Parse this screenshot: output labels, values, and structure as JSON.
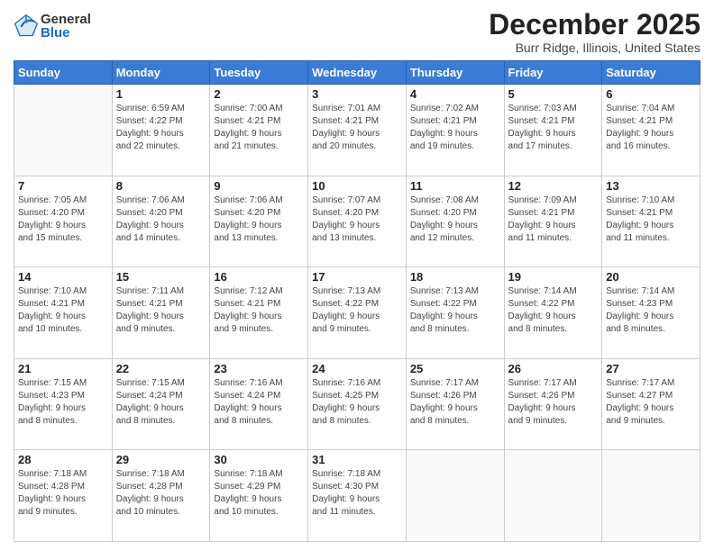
{
  "logo": {
    "general": "General",
    "blue": "Blue"
  },
  "header": {
    "title": "December 2025",
    "subtitle": "Burr Ridge, Illinois, United States"
  },
  "days_of_week": [
    "Sunday",
    "Monday",
    "Tuesday",
    "Wednesday",
    "Thursday",
    "Friday",
    "Saturday"
  ],
  "weeks": [
    [
      {
        "day": "",
        "info": ""
      },
      {
        "day": "1",
        "info": "Sunrise: 6:59 AM\nSunset: 4:22 PM\nDaylight: 9 hours\nand 22 minutes."
      },
      {
        "day": "2",
        "info": "Sunrise: 7:00 AM\nSunset: 4:21 PM\nDaylight: 9 hours\nand 21 minutes."
      },
      {
        "day": "3",
        "info": "Sunrise: 7:01 AM\nSunset: 4:21 PM\nDaylight: 9 hours\nand 20 minutes."
      },
      {
        "day": "4",
        "info": "Sunrise: 7:02 AM\nSunset: 4:21 PM\nDaylight: 9 hours\nand 19 minutes."
      },
      {
        "day": "5",
        "info": "Sunrise: 7:03 AM\nSunset: 4:21 PM\nDaylight: 9 hours\nand 17 minutes."
      },
      {
        "day": "6",
        "info": "Sunrise: 7:04 AM\nSunset: 4:21 PM\nDaylight: 9 hours\nand 16 minutes."
      }
    ],
    [
      {
        "day": "7",
        "info": "Sunrise: 7:05 AM\nSunset: 4:20 PM\nDaylight: 9 hours\nand 15 minutes."
      },
      {
        "day": "8",
        "info": "Sunrise: 7:06 AM\nSunset: 4:20 PM\nDaylight: 9 hours\nand 14 minutes."
      },
      {
        "day": "9",
        "info": "Sunrise: 7:06 AM\nSunset: 4:20 PM\nDaylight: 9 hours\nand 13 minutes."
      },
      {
        "day": "10",
        "info": "Sunrise: 7:07 AM\nSunset: 4:20 PM\nDaylight: 9 hours\nand 13 minutes."
      },
      {
        "day": "11",
        "info": "Sunrise: 7:08 AM\nSunset: 4:20 PM\nDaylight: 9 hours\nand 12 minutes."
      },
      {
        "day": "12",
        "info": "Sunrise: 7:09 AM\nSunset: 4:21 PM\nDaylight: 9 hours\nand 11 minutes."
      },
      {
        "day": "13",
        "info": "Sunrise: 7:10 AM\nSunset: 4:21 PM\nDaylight: 9 hours\nand 11 minutes."
      }
    ],
    [
      {
        "day": "14",
        "info": "Sunrise: 7:10 AM\nSunset: 4:21 PM\nDaylight: 9 hours\nand 10 minutes."
      },
      {
        "day": "15",
        "info": "Sunrise: 7:11 AM\nSunset: 4:21 PM\nDaylight: 9 hours\nand 9 minutes."
      },
      {
        "day": "16",
        "info": "Sunrise: 7:12 AM\nSunset: 4:21 PM\nDaylight: 9 hours\nand 9 minutes."
      },
      {
        "day": "17",
        "info": "Sunrise: 7:13 AM\nSunset: 4:22 PM\nDaylight: 9 hours\nand 9 minutes."
      },
      {
        "day": "18",
        "info": "Sunrise: 7:13 AM\nSunset: 4:22 PM\nDaylight: 9 hours\nand 8 minutes."
      },
      {
        "day": "19",
        "info": "Sunrise: 7:14 AM\nSunset: 4:22 PM\nDaylight: 9 hours\nand 8 minutes."
      },
      {
        "day": "20",
        "info": "Sunrise: 7:14 AM\nSunset: 4:23 PM\nDaylight: 9 hours\nand 8 minutes."
      }
    ],
    [
      {
        "day": "21",
        "info": "Sunrise: 7:15 AM\nSunset: 4:23 PM\nDaylight: 9 hours\nand 8 minutes."
      },
      {
        "day": "22",
        "info": "Sunrise: 7:15 AM\nSunset: 4:24 PM\nDaylight: 9 hours\nand 8 minutes."
      },
      {
        "day": "23",
        "info": "Sunrise: 7:16 AM\nSunset: 4:24 PM\nDaylight: 9 hours\nand 8 minutes."
      },
      {
        "day": "24",
        "info": "Sunrise: 7:16 AM\nSunset: 4:25 PM\nDaylight: 9 hours\nand 8 minutes."
      },
      {
        "day": "25",
        "info": "Sunrise: 7:17 AM\nSunset: 4:26 PM\nDaylight: 9 hours\nand 8 minutes."
      },
      {
        "day": "26",
        "info": "Sunrise: 7:17 AM\nSunset: 4:26 PM\nDaylight: 9 hours\nand 9 minutes."
      },
      {
        "day": "27",
        "info": "Sunrise: 7:17 AM\nSunset: 4:27 PM\nDaylight: 9 hours\nand 9 minutes."
      }
    ],
    [
      {
        "day": "28",
        "info": "Sunrise: 7:18 AM\nSunset: 4:28 PM\nDaylight: 9 hours\nand 9 minutes."
      },
      {
        "day": "29",
        "info": "Sunrise: 7:18 AM\nSunset: 4:28 PM\nDaylight: 9 hours\nand 10 minutes."
      },
      {
        "day": "30",
        "info": "Sunrise: 7:18 AM\nSunset: 4:29 PM\nDaylight: 9 hours\nand 10 minutes."
      },
      {
        "day": "31",
        "info": "Sunrise: 7:18 AM\nSunset: 4:30 PM\nDaylight: 9 hours\nand 11 minutes."
      },
      {
        "day": "",
        "info": ""
      },
      {
        "day": "",
        "info": ""
      },
      {
        "day": "",
        "info": ""
      }
    ]
  ]
}
